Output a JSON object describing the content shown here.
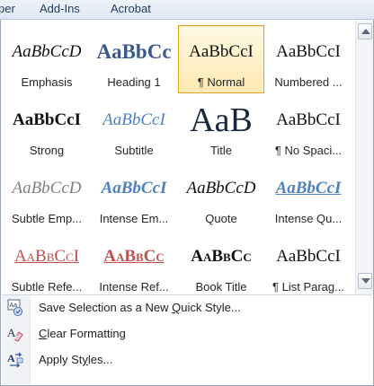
{
  "tabs": [
    {
      "label": "per"
    },
    {
      "label": "Add-Ins"
    },
    {
      "label": "Acrobat"
    }
  ],
  "styles": [
    {
      "preview": "AaBbCcD",
      "label": "Emphasis",
      "cls": "p-emphasis"
    },
    {
      "preview": "AaBbCc",
      "label": "Heading 1",
      "cls": "p-heading1"
    },
    {
      "preview": "AaBbCcI",
      "label": "¶ Normal",
      "cls": "p-normal",
      "selected": true
    },
    {
      "preview": "AaBbCcI",
      "label": "Numbered ...",
      "cls": "p-numbered"
    },
    {
      "preview": "AaBbCcI",
      "label": "Strong",
      "cls": "p-strong"
    },
    {
      "preview": "AaBbCcI",
      "label": "Subtitle",
      "cls": "p-subtitle"
    },
    {
      "preview": "AaB",
      "label": "Title",
      "cls": "p-title"
    },
    {
      "preview": "AaBbCcI",
      "label": "¶ No Spaci...",
      "cls": "p-nospacing"
    },
    {
      "preview": "AaBbCcD",
      "label": "Subtle Emp...",
      "cls": "p-subtle"
    },
    {
      "preview": "AaBbCcI",
      "label": "Intense Em...",
      "cls": "p-intense"
    },
    {
      "preview": "AaBbCcD",
      "label": "Quote",
      "cls": "p-quote"
    },
    {
      "preview": "AaBbCcI",
      "label": "Intense Qu...",
      "cls": "p-intensequote"
    },
    {
      "preview": "AaBbCcI",
      "label": "Subtle Refe...",
      "cls": "p-subtleref"
    },
    {
      "preview": "AaBbCc",
      "label": "Intense Ref...",
      "cls": "p-intenseref"
    },
    {
      "preview": "AaBbCc",
      "label": "Book Title",
      "cls": "p-booktitle"
    },
    {
      "preview": "AaBbCcI",
      "label": "¶ List Parag...",
      "cls": "p-listpara"
    }
  ],
  "menu": {
    "save": {
      "pre": "Save Selection as a New ",
      "key": "Q",
      "post": "uick Style...",
      "icon": "save-style-icon"
    },
    "clear": {
      "pre": "",
      "key": "C",
      "post": "lear Formatting",
      "icon": "clear-formatting-icon"
    },
    "apply": {
      "pre": "Apply St",
      "key": "y",
      "post": "les...",
      "icon": "apply-styles-icon"
    }
  },
  "colors": {
    "selected_border": "#e3a21a",
    "accent_blue": "#4f81bd",
    "accent_red": "#c0504d"
  }
}
